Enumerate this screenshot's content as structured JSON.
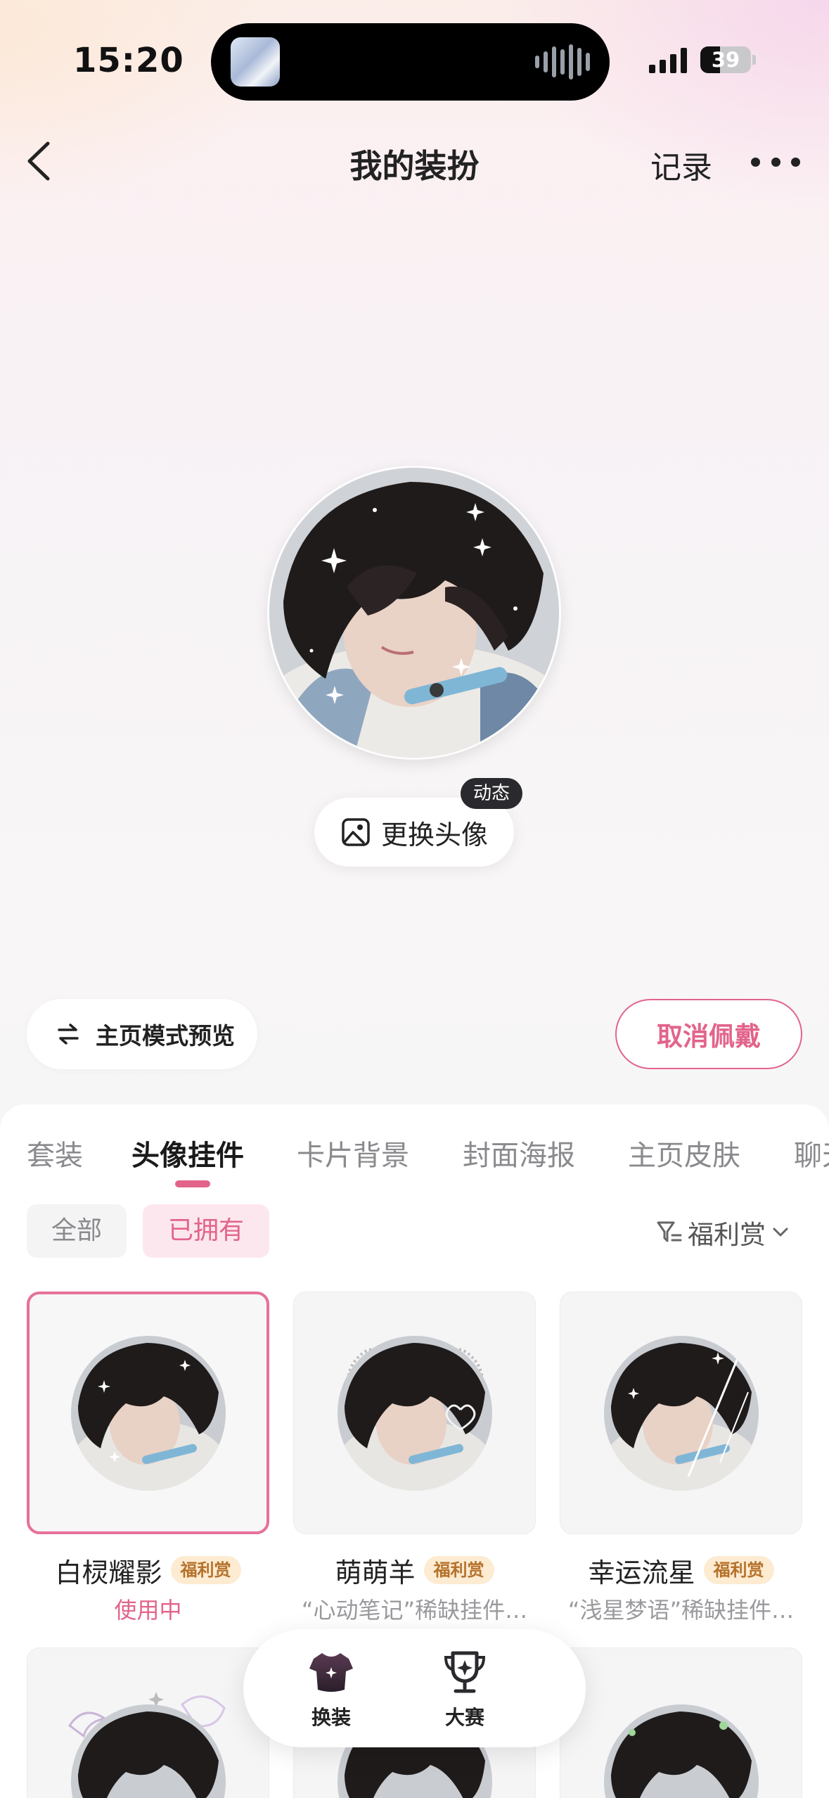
{
  "status_bar": {
    "time": "15:20",
    "battery": "39",
    "battery_level": 0.39
  },
  "header": {
    "title": "我的装扮",
    "record": "记录"
  },
  "avatar_section": {
    "change_avatar_label": "更换头像",
    "dynamic_badge": "动态"
  },
  "actions": {
    "preview_label": "主页模式预览",
    "cancel_label": "取消佩戴"
  },
  "tabs": [
    {
      "label": "套装",
      "active": false
    },
    {
      "label": "头像挂件",
      "active": true
    },
    {
      "label": "卡片背景",
      "active": false
    },
    {
      "label": "封面海报",
      "active": false
    },
    {
      "label": "主页皮肤",
      "active": false
    },
    {
      "label": "聊天",
      "active": false
    }
  ],
  "filters": {
    "all": "全部",
    "owned": "已拥有",
    "sort": "福利赏"
  },
  "items": [
    {
      "name": "白棂耀影",
      "badge": "福利赏",
      "sub": "使用中",
      "selected": true
    },
    {
      "name": "萌萌羊",
      "badge": "福利赏",
      "sub": "“心动笔记”稀缺挂件…",
      "selected": false
    },
    {
      "name": "幸运流星",
      "badge": "福利赏",
      "sub": "“浅星梦语”稀缺挂件…",
      "selected": false
    }
  ],
  "bottom_nav": [
    {
      "label": "换装",
      "icon": "shirt-icon"
    },
    {
      "label": "大赛",
      "icon": "trophy-icon"
    }
  ],
  "colors": {
    "accent": "#e2648b",
    "badge_bg": "#fdebd2",
    "badge_text": "#b5722b"
  }
}
